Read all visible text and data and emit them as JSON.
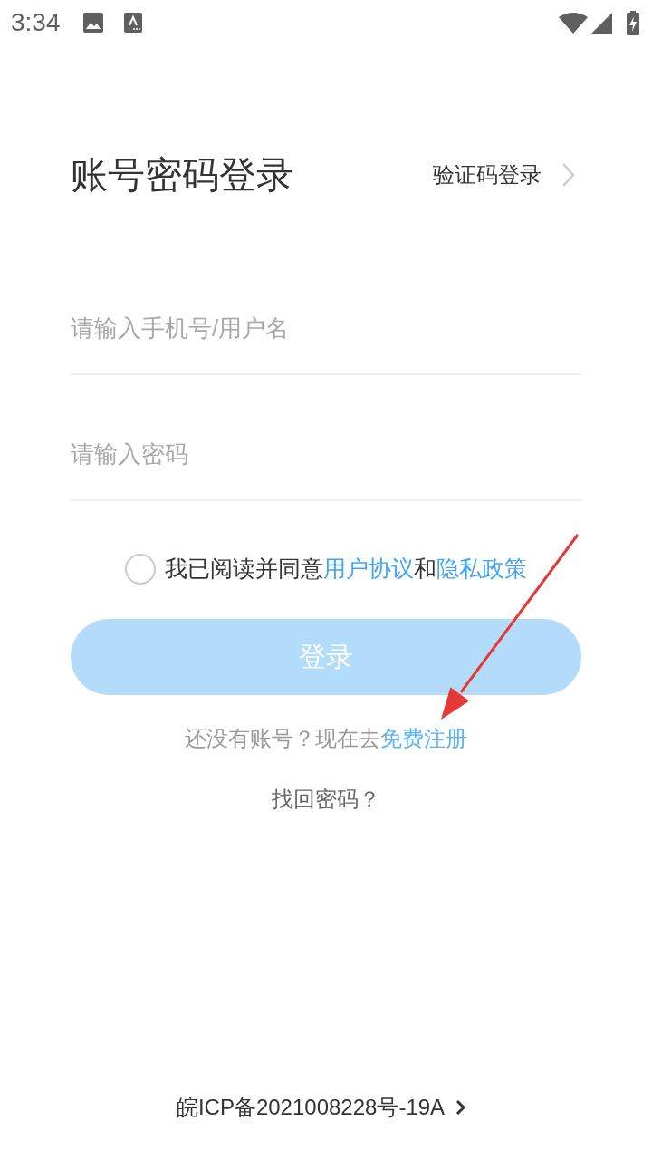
{
  "status_bar": {
    "time": "3:34"
  },
  "header": {
    "title": "账号密码登录",
    "switch_link": "验证码登录"
  },
  "fields": [
    {
      "placeholder": "请输入手机号/用户名"
    },
    {
      "placeholder": "请输入密码"
    }
  ],
  "agreement": {
    "checked": false,
    "parts": [
      {
        "kind": "text",
        "text": "我已阅读并同意"
      },
      {
        "kind": "link",
        "text": "用户协议"
      },
      {
        "kind": "text",
        "text": "和"
      },
      {
        "kind": "link",
        "text": "隐私政策"
      }
    ]
  },
  "login_button": {
    "label": "登录",
    "disabled": true
  },
  "register": {
    "prompt": "还没有账号？现在去",
    "link": "免费注册"
  },
  "forgot_password": "找回密码？",
  "footer": {
    "icp": "皖ICP备2021008228号-19A"
  }
}
